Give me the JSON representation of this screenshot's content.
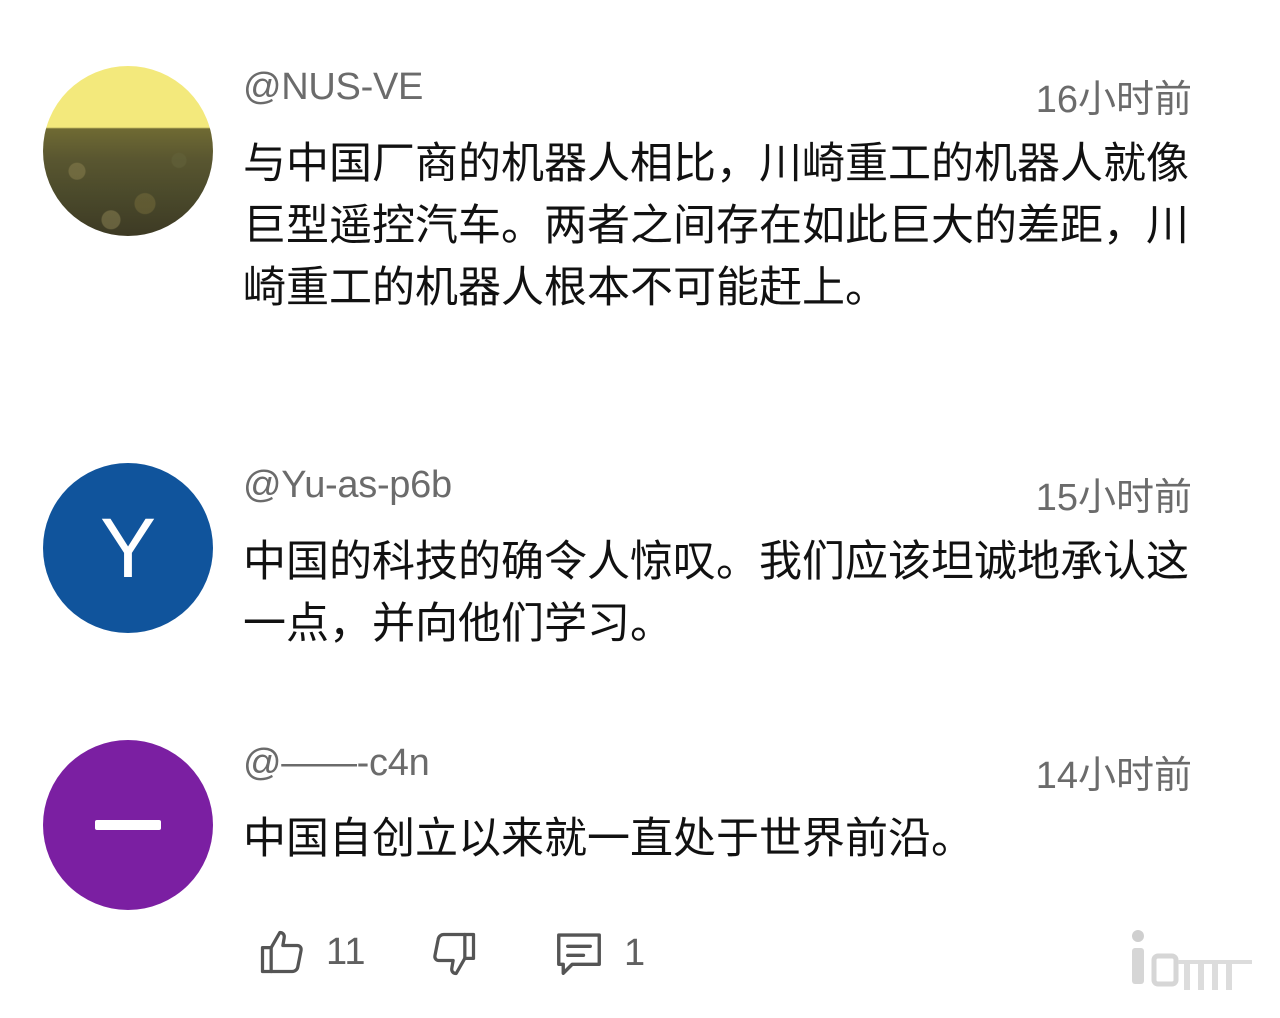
{
  "comments": [
    {
      "handle": "@NUS-VE",
      "time": "16小时前",
      "text": "与中国厂商的机器人相比，川崎重工的机器人就像巨型遥控汽车。两者之间存在如此巨大的差距，川崎重工的机器人根本不可能赶上。",
      "avatar": "photo"
    },
    {
      "handle": "@Yu-as-p6b",
      "time": "15小时前",
      "text": "中国的科技的确令人惊叹。我们应该坦诚地承认这一点，并向他们学习。",
      "avatar_letter": "Y",
      "avatar_color": "#10549c"
    },
    {
      "handle": "@——-c4n",
      "time": "14小时前",
      "text": "中国自创立以来就一直处于世界前沿。",
      "avatar_letter": "一",
      "avatar_color": "#7b1fa2"
    }
  ],
  "actions": {
    "like_count": "11",
    "reply_count": "1",
    "like_icon": "thumbs-up-icon",
    "dislike_icon": "thumbs-down-icon",
    "reply_icon": "comment-icon"
  }
}
